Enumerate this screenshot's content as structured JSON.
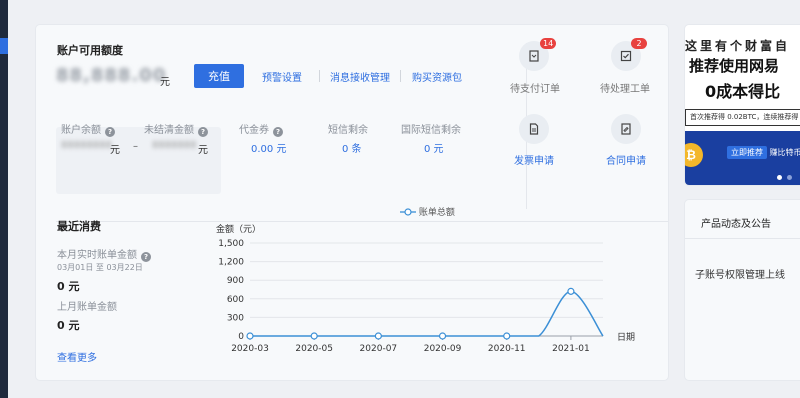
{
  "account": {
    "title": "账户可用额度",
    "balance_masked": "88,888.00",
    "unit": "元",
    "charge_button": "充值",
    "links": [
      "预警设置",
      "消息接收管理",
      "购买资源包"
    ]
  },
  "details": {
    "balance_label": "账户余额",
    "balance_masked": "88888888",
    "balance_unit": "元",
    "dash": "–",
    "unsettled_label": "未结清金额",
    "unsettled_masked": "8888888",
    "unsettled_unit": "元",
    "coupon_label": "代金券",
    "coupon_value": "0.00 元",
    "sms_label": "短信剩余",
    "sms_value": "0 条",
    "intl_sms_label": "国际短信剩余",
    "intl_sms_value": "0 元"
  },
  "quick_actions": {
    "pending_payment": {
      "label": "待支付订单",
      "badge": "14"
    },
    "pending_tickets": {
      "label": "待处理工单",
      "badge": "2"
    },
    "invoice": {
      "label": "发票申请"
    },
    "contract": {
      "label": "合同申请"
    }
  },
  "recent": {
    "title": "最近消费",
    "this_month_label": "本月实时账单金额",
    "date_range": "03月01日 至 03月22日",
    "this_month_value": "0 元",
    "last_month_label": "上月账单金额",
    "last_month_value": "0 元",
    "see_more": "查看更多"
  },
  "chart_data": {
    "type": "line",
    "legend": "账单总额",
    "ylabel": "金额（元）",
    "xlabel": "日期",
    "x": [
      "2020-03",
      "2020-04",
      "2020-05",
      "2020-06",
      "2020-07",
      "2020-08",
      "2020-09",
      "2020-10",
      "2020-11",
      "2020-12",
      "2021-01",
      "2021-02"
    ],
    "x_ticks": [
      "2020-03",
      "2020-05",
      "2020-07",
      "2020-09",
      "2020-11",
      "2021-01"
    ],
    "series": [
      {
        "name": "账单总额",
        "values": [
          0,
          0,
          0,
          0,
          0,
          0,
          0,
          0,
          0,
          0,
          720,
          0
        ]
      }
    ],
    "marker_indices": [
      0,
      2,
      4,
      6,
      8,
      10
    ],
    "y_ticks": [
      "0",
      "300",
      "600",
      "900",
      "1,200",
      "1,500"
    ],
    "ylim": [
      0,
      1500
    ],
    "line_color": "#3b8fd6"
  },
  "promo": {
    "line1": "这里有个财富自",
    "line2": "推荐使用网易",
    "line3": "0成本得比",
    "line4": "首次推荐得 0.02BTC，连续推荐得",
    "button": "立即推荐",
    "button_tail": "赚比特币"
  },
  "news": {
    "title": "产品动态及公告",
    "item1": "子账号权限管理上线"
  }
}
